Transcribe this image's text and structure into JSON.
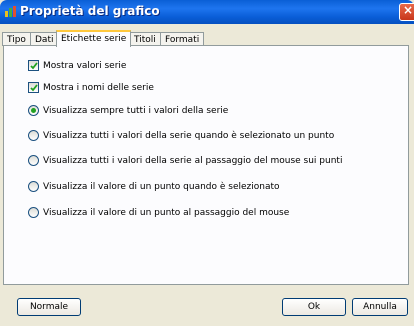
{
  "window": {
    "title": "Proprietà del grafico",
    "close_label": "×"
  },
  "tabs": [
    {
      "label": "Tipo"
    },
    {
      "label": "Dati"
    },
    {
      "label": "Etichette serie"
    },
    {
      "label": "Titoli"
    },
    {
      "label": "Formati"
    }
  ],
  "active_tab": "Etichette serie",
  "checkboxes": [
    {
      "label": "Mostra valori serie",
      "checked": true
    },
    {
      "label": "Mostra i nomi delle serie",
      "checked": true
    }
  ],
  "radios": [
    {
      "label": "Visualizza sempre tutti i valori della serie",
      "selected": true
    },
    {
      "label": "Visualizza tutti i valori della serie quando è selezionato un punto",
      "selected": false
    },
    {
      "label": "Visualizza tutti i valori della serie al passaggio del mouse sui punti",
      "selected": false
    },
    {
      "label": "Visualizza il valore di un punto quando è selezionato",
      "selected": false
    },
    {
      "label": "Visualizza il valore di un punto al passaggio del mouse",
      "selected": false
    }
  ],
  "buttons": {
    "default_label": "Normale",
    "ok_label": "Ok",
    "cancel_label": "Annulla"
  },
  "colors": {
    "titlebar": "#0a5fd6",
    "dialog_bg": "#ece9d8",
    "check_green": "#21a121"
  }
}
